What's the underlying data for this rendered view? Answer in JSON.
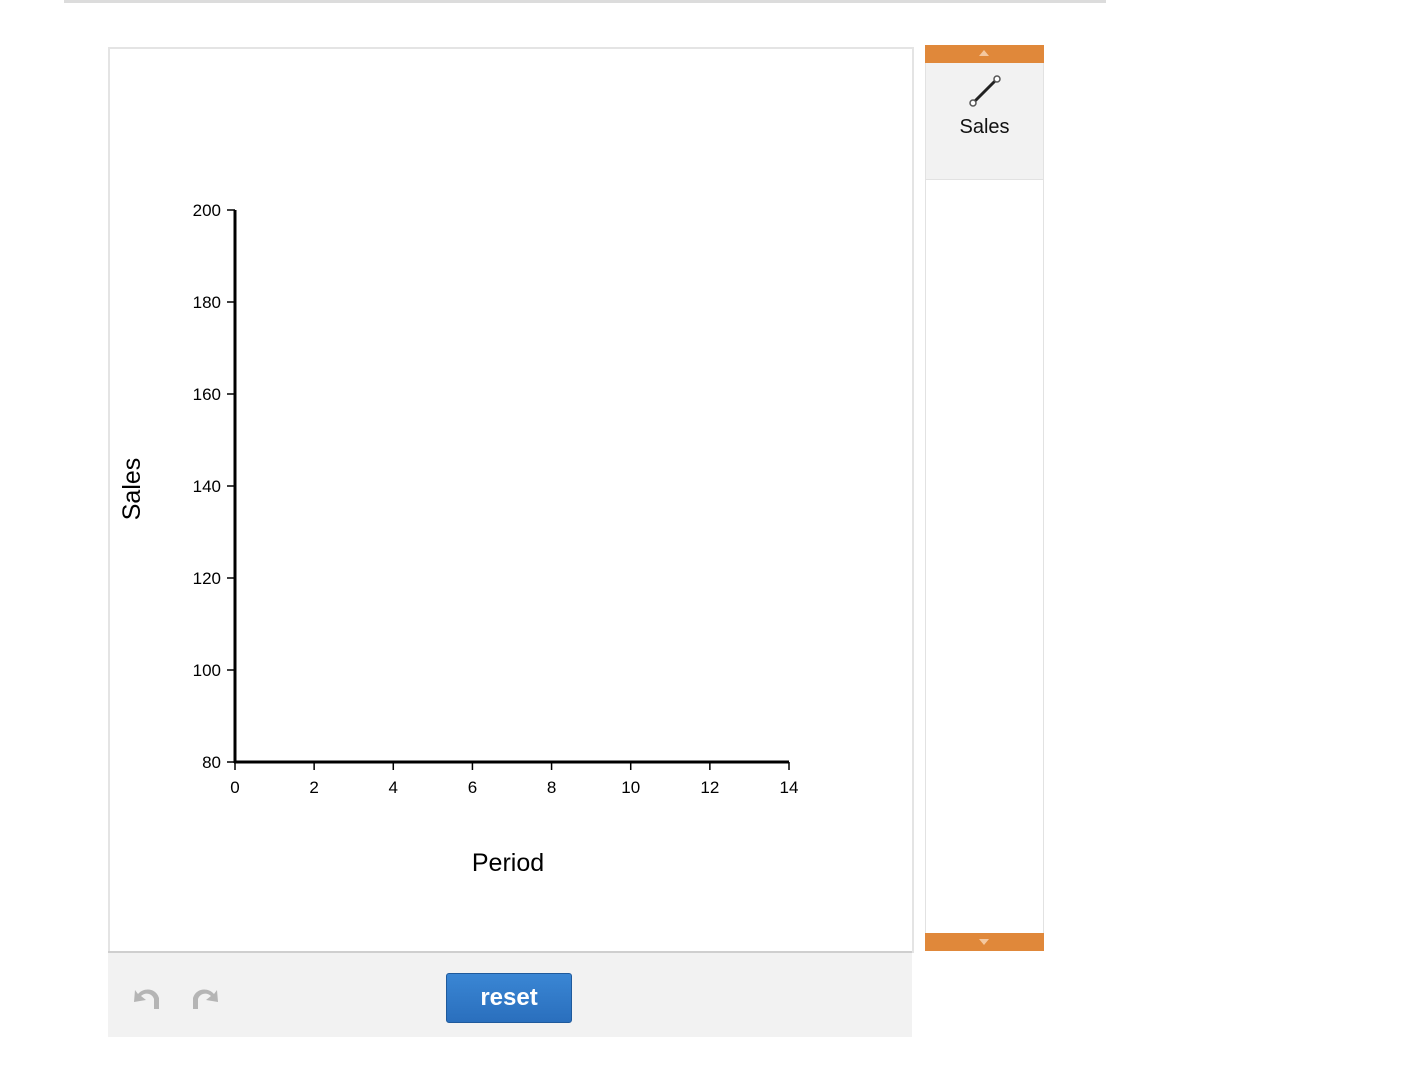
{
  "chart_data": {
    "type": "line",
    "xlabel": "Period",
    "ylabel": "Sales",
    "xlim": [
      0,
      14
    ],
    "ylim": [
      80,
      200
    ],
    "x_ticks": [
      0,
      2,
      4,
      6,
      8,
      10,
      12,
      14
    ],
    "y_ticks": [
      80,
      100,
      120,
      140,
      160,
      180,
      200
    ],
    "grid": false,
    "series": []
  },
  "toolbar": {
    "undo_icon": "undo-icon",
    "redo_icon": "redo-icon",
    "reset_label": "reset"
  },
  "palette": {
    "items": [
      {
        "label": "Sales",
        "icon": "line-segment-icon"
      }
    ],
    "accent_color": "#e0883a"
  }
}
